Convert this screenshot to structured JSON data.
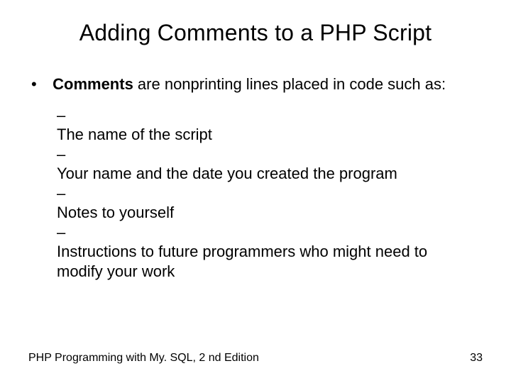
{
  "title": "Adding Comments to a PHP Script",
  "main": {
    "bold": "Comments",
    "rest": " are nonprinting lines placed in code such as:"
  },
  "sub": [
    "The name of the script",
    "Your name and the date you created the program",
    "Notes to yourself",
    "Instructions to future programmers who might need to modify your work"
  ],
  "footer": {
    "left": "PHP Programming with My. SQL, 2 nd Edition",
    "right": "33"
  }
}
